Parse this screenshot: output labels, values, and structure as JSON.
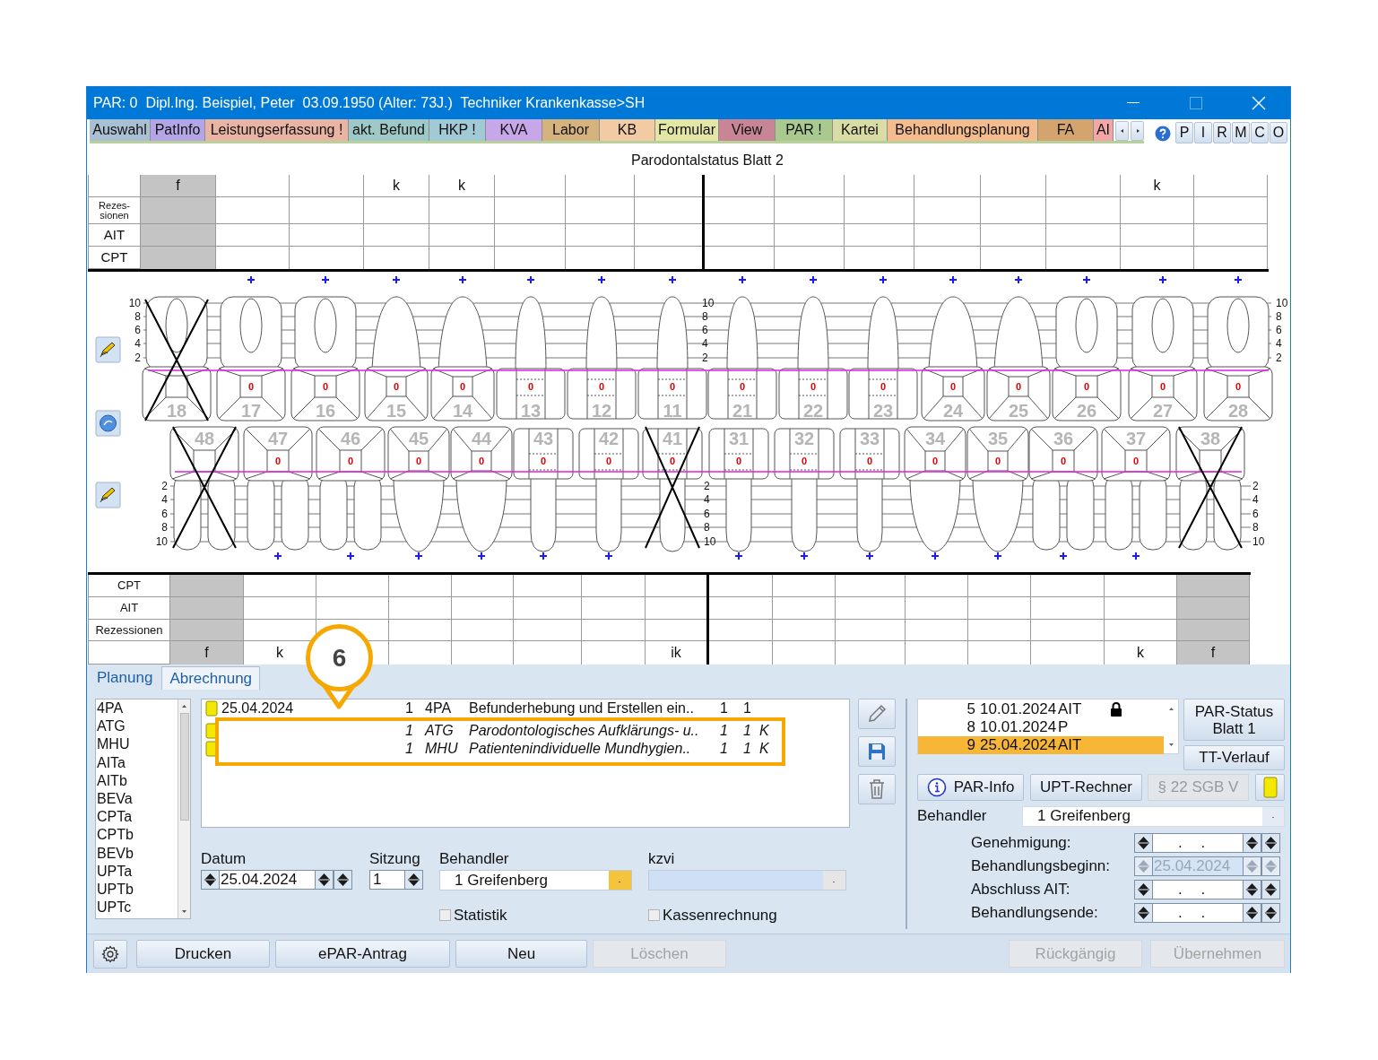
{
  "window": {
    "title": "PAR: 0  Dipl.Ing. Beispiel, Peter  03.09.1950 (Alter: 73J.)  Techniker Krankenkasse>SH"
  },
  "tabs": [
    {
      "label": "Auswahl",
      "color": "#a9bfd4"
    },
    {
      "label": "PatInfo",
      "color": "#b4a6e6"
    },
    {
      "label": "Leistungserfassung !",
      "color": "#e9b4a4"
    },
    {
      "label": "akt. Befund",
      "color": "#9fc9c9"
    },
    {
      "label": "HKP !",
      "color": "#9fcad6"
    },
    {
      "label": "KVA",
      "color": "#c7a7e7"
    },
    {
      "label": "Labor",
      "color": "#d6b27f"
    },
    {
      "label": "KB",
      "color": "#f2caa4"
    },
    {
      "label": "Formular",
      "color": "#e4e6a6"
    },
    {
      "label": "View",
      "color": "#c78595"
    },
    {
      "label": "PAR !",
      "color": "#a9c98e"
    },
    {
      "label": "Kartei",
      "color": "#d9dca4"
    },
    {
      "label": "Behandlungsplanung",
      "color": "#f4bb8d"
    },
    {
      "label": "FA",
      "color": "#d4a46e"
    },
    {
      "label": "AI",
      "color": "#f4a6a6"
    }
  ],
  "toolbar_buttons": [
    "P",
    "I",
    "R",
    "M",
    "C",
    "O"
  ],
  "chart_title": "Parodontalstatus Blatt 2",
  "upper_table": {
    "row_labels": [
      "Rezes-\nsionen",
      "AIT",
      "CPT"
    ],
    "columns": [
      {
        "mark": "f",
        "shaded": true
      },
      {
        "shaded": false
      },
      {
        "shaded": false
      },
      {
        "mark": "k",
        "shaded": false
      },
      {
        "mark": "k",
        "shaded": false
      },
      {
        "shaded": false
      },
      {
        "shaded": false
      },
      {
        "shaded": false
      },
      {
        "shaded": false
      },
      {
        "shaded": false
      },
      {
        "shaded": false
      },
      {
        "shaded": false
      },
      {
        "shaded": false
      },
      {
        "shaded": false
      },
      {
        "mark": "k",
        "shaded": false
      },
      {
        "shaded": false
      }
    ]
  },
  "chart": {
    "upper_scales": [
      [
        "10",
        "8",
        "6",
        "4",
        "2"
      ],
      [
        "10",
        "8",
        "6",
        "4",
        "2"
      ],
      [
        "10",
        "8",
        "6",
        "4",
        "2"
      ]
    ],
    "lower_scales": [
      [
        "2",
        "4",
        "6",
        "8",
        "10"
      ],
      [
        "2",
        "4",
        "6",
        "8",
        "10"
      ],
      [
        "2",
        "4",
        "6",
        "8",
        "10"
      ]
    ],
    "upper_teeth": [
      {
        "number": "18",
        "kind": "molar",
        "missing": true
      },
      {
        "number": "17",
        "kind": "molar",
        "missing": false,
        "value": "0"
      },
      {
        "number": "16",
        "kind": "molar",
        "missing": false,
        "value": "0"
      },
      {
        "number": "15",
        "kind": "premolar",
        "missing": false,
        "value": "0"
      },
      {
        "number": "14",
        "kind": "premolar",
        "missing": false,
        "value": "0"
      },
      {
        "number": "13",
        "kind": "anterior",
        "missing": false,
        "value": "0"
      },
      {
        "number": "12",
        "kind": "anterior",
        "missing": false,
        "value": "0"
      },
      {
        "number": "11",
        "kind": "anterior",
        "missing": false,
        "value": "0"
      },
      {
        "number": "21",
        "kind": "anterior",
        "missing": false,
        "value": "0"
      },
      {
        "number": "22",
        "kind": "anterior",
        "missing": false,
        "value": "0"
      },
      {
        "number": "23",
        "kind": "anterior",
        "missing": false,
        "value": "0"
      },
      {
        "number": "24",
        "kind": "premolar",
        "missing": false,
        "value": "0"
      },
      {
        "number": "25",
        "kind": "premolar",
        "missing": false,
        "value": "0"
      },
      {
        "number": "26",
        "kind": "molar",
        "missing": false,
        "value": "0"
      },
      {
        "number": "27",
        "kind": "molar",
        "missing": false,
        "value": "0"
      },
      {
        "number": "28",
        "kind": "molar",
        "missing": false,
        "value": "0"
      }
    ],
    "lower_teeth": [
      {
        "number": "48",
        "kind": "molar",
        "missing": true
      },
      {
        "number": "47",
        "kind": "molar",
        "missing": false,
        "value": "0"
      },
      {
        "number": "46",
        "kind": "molar",
        "missing": false,
        "value": "0"
      },
      {
        "number": "45",
        "kind": "premolar",
        "missing": false,
        "value": "0"
      },
      {
        "number": "44",
        "kind": "premolar",
        "missing": false,
        "value": "0"
      },
      {
        "number": "43",
        "kind": "anterior",
        "missing": false,
        "value": "0"
      },
      {
        "number": "42",
        "kind": "anterior",
        "missing": false,
        "value": "0"
      },
      {
        "number": "41",
        "kind": "anterior",
        "missing": true,
        "value": "0"
      },
      {
        "number": "31",
        "kind": "anterior",
        "missing": false,
        "value": "0"
      },
      {
        "number": "32",
        "kind": "anterior",
        "missing": false,
        "value": "0"
      },
      {
        "number": "33",
        "kind": "anterior",
        "missing": false,
        "value": "0"
      },
      {
        "number": "34",
        "kind": "premolar",
        "missing": false,
        "value": "0"
      },
      {
        "number": "35",
        "kind": "premolar",
        "missing": false,
        "value": "0"
      },
      {
        "number": "36",
        "kind": "molar",
        "missing": false,
        "value": "0"
      },
      {
        "number": "37",
        "kind": "molar",
        "missing": false,
        "value": "0"
      },
      {
        "number": "38",
        "kind": "molar",
        "missing": true
      }
    ]
  },
  "lower_table": {
    "row_labels": [
      "CPT",
      "AIT",
      "Rezessionen"
    ],
    "columns": [
      {
        "mark": "f",
        "shaded": true
      },
      {
        "mark": "k",
        "shaded": false
      },
      {
        "shaded": false
      },
      {
        "shaded": false
      },
      {
        "shaded": false
      },
      {
        "shaded": false
      },
      {
        "shaded": false
      },
      {
        "mark": "ik",
        "shaded": false
      },
      {
        "shaded": false
      },
      {
        "shaded": false
      },
      {
        "shaded": false
      },
      {
        "shaded": false
      },
      {
        "shaded": false
      },
      {
        "shaded": false
      },
      {
        "mark": "k",
        "shaded": false
      },
      {
        "mark": "f",
        "shaded": true
      }
    ]
  },
  "panel_tabs": [
    {
      "label": "Planung",
      "selected": false
    },
    {
      "label": "Abrechnung",
      "selected": true
    }
  ],
  "callout": {
    "number": "6"
  },
  "code_list": [
    "4PA",
    "ATG",
    "MHU",
    "AITa",
    "AITb",
    "BEVa",
    "CPTa",
    "CPTb",
    "BEVb",
    "UPTa",
    "UPTb",
    "UPTc"
  ],
  "services": [
    {
      "date": "25.04.2024",
      "count": "1",
      "code": "4PA",
      "text": "Befunderhebung und Erstellen ein..",
      "qty1": "1",
      "qty2": "1",
      "italic": false
    },
    {
      "count": "1",
      "code": "ATG",
      "text": "Parodontologisches Aufklärungs- u..",
      "qty1": "1",
      "qty2": "1",
      "flag": "K",
      "italic": true
    },
    {
      "count": "1",
      "code": "MHU",
      "text": "Patientenindividuelle Mundhygien..",
      "qty1": "1",
      "qty2": "1",
      "flag": "K",
      "italic": true
    }
  ],
  "form": {
    "datum": {
      "label": "Datum",
      "value": "25.04.2024"
    },
    "sitzung": {
      "label": "Sitzung",
      "value": "1"
    },
    "behandler": {
      "label": "Behandler",
      "value": "1 Greifenberg"
    },
    "kzvi": {
      "label": "kzvi"
    },
    "checkboxes": [
      {
        "label": "Statistik",
        "checked": false
      },
      {
        "label": "Kassenrechnung",
        "checked": false
      }
    ]
  },
  "status_list": [
    {
      "number": "5",
      "date": "10.01.2024",
      "type": "AIT",
      "locked": true,
      "selected": false
    },
    {
      "number": "8",
      "date": "10.01.2024",
      "type": "P",
      "locked": false,
      "selected": false
    },
    {
      "number": "9",
      "date": "25.04.2024",
      "type": "AIT",
      "locked": false,
      "selected": true
    }
  ],
  "status_buttons": [
    "PAR-Status Blatt 1",
    "TT-Verlauf"
  ],
  "right_buttons": [
    {
      "label": "PAR-Info",
      "disabled": false
    },
    {
      "label": "UPT-Rechner",
      "disabled": false
    },
    {
      "label": "§ 22 SGB V",
      "disabled": true
    }
  ],
  "right_behandler": {
    "label": "Behandler",
    "value": "1 Greifenberg"
  },
  "dates": [
    {
      "label": "Genehmigung:",
      "value": ". .",
      "disabled": false
    },
    {
      "label": "Behandlungsbeginn:",
      "value": "25.04.2024",
      "disabled": true
    },
    {
      "label": "Abschluss AIT:",
      "value": ". .",
      "disabled": false
    },
    {
      "label": "Behandlungsende:",
      "value": ". .",
      "disabled": false
    }
  ],
  "bottom_buttons": [
    {
      "label": "Drucken",
      "disabled": false
    },
    {
      "label": "ePAR-Antrag",
      "disabled": false
    },
    {
      "label": "Neu",
      "disabled": false
    },
    {
      "label": "Löschen",
      "disabled": true
    }
  ],
  "bottom_right_buttons": [
    {
      "label": "Rückgängig",
      "disabled": true
    },
    {
      "label": "Übernehmen",
      "disabled": true
    }
  ]
}
